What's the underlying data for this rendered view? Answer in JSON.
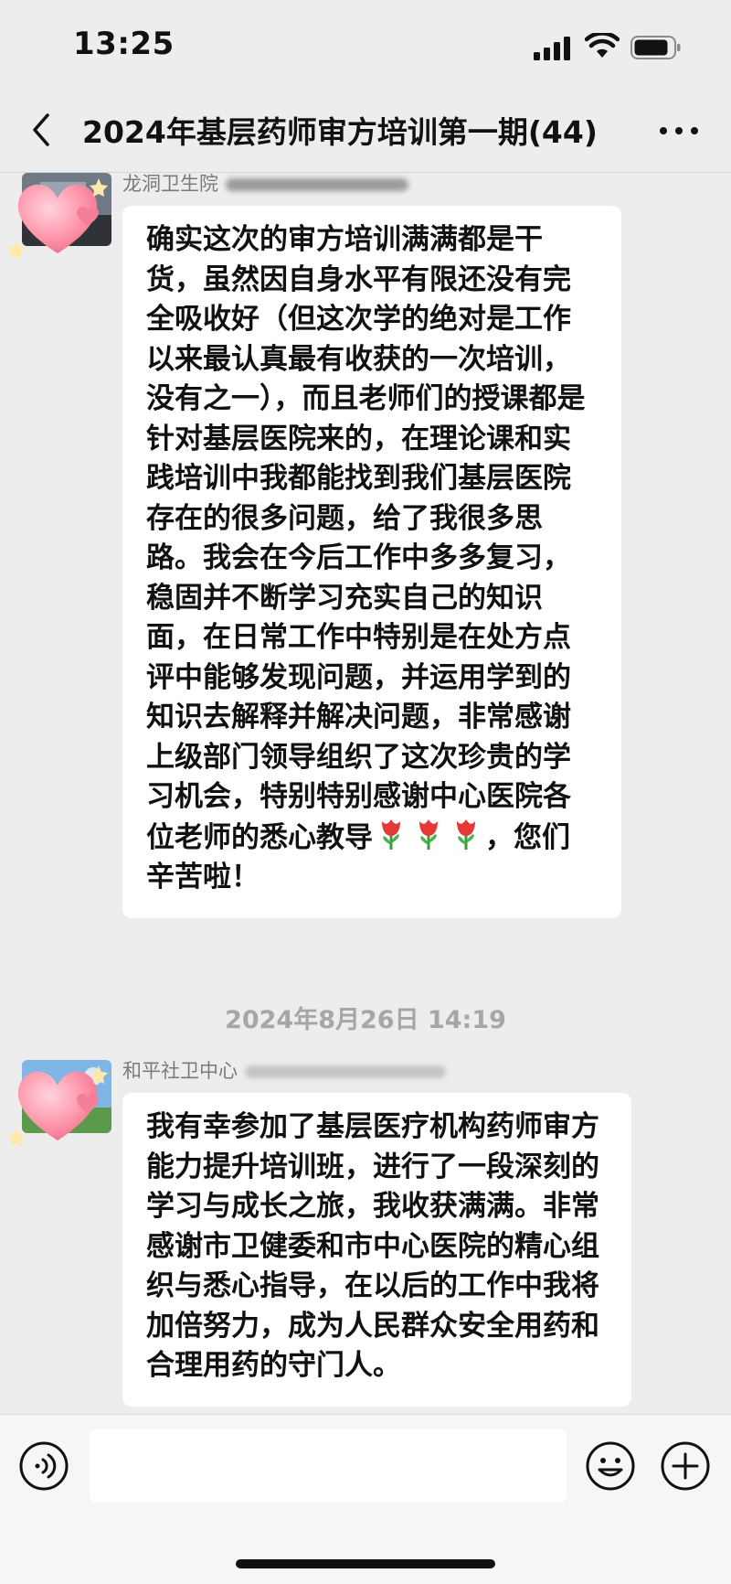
{
  "status_bar": {
    "time": "13:25"
  },
  "header": {
    "title": "2024年基层药师审方培训第一期(44)",
    "back_icon": "chevron-left-icon",
    "more_icon": "more-dots-icon"
  },
  "messages": [
    {
      "sender": "龙洞卫生院",
      "avatar_icon": "heart-sticker-avatar",
      "text": "确实这次的审方培训满满都是干货，虽然因自身水平有限还没有完全吸收好（但这次学的绝对是工作以来最认真最有收获的一次培训，没有之一），而且老师们的授课都是针对基层医院来的，在理论课和实践培训中我都能找到我们基层医院存在的很多问题，给了我很多思路。我会在今后工作中多多复习，稳固并不断学习充实自己的知识面，在日常工作中特别是在处方点评中能够发现问题，并运用学到的知识去解释并解决问题，非常感谢上级部门领导组织了这次珍贵的学习机会，特别特别感谢中心医院各位老师的悉心教导",
      "text_end": "，您们辛苦啦！",
      "emoji": "tulip-emoji"
    },
    {
      "sender": "和平社卫中心",
      "avatar_icon": "heart-sticker-avatar",
      "text": "我有幸参加了基层医疗机构药师审方能力提升培训班，进行了一段深刻的学习与成长之旅，我收获满满。非常感谢市卫健委和市中心医院的精心组织与悉心指导，在以后的工作中我将加倍努力，成为人民群众安全用药和合理用药的守门人。"
    }
  ],
  "timestamp": "2024年8月26日 14:19",
  "input_bar": {
    "voice_icon": "voice-icon",
    "emoji_icon": "emoji-smile-icon",
    "plus_icon": "plus-icon",
    "input_value": ""
  },
  "colors": {
    "background": "#ededed",
    "bubble": "#ffffff",
    "timestamp_text": "#a6a6a6"
  }
}
